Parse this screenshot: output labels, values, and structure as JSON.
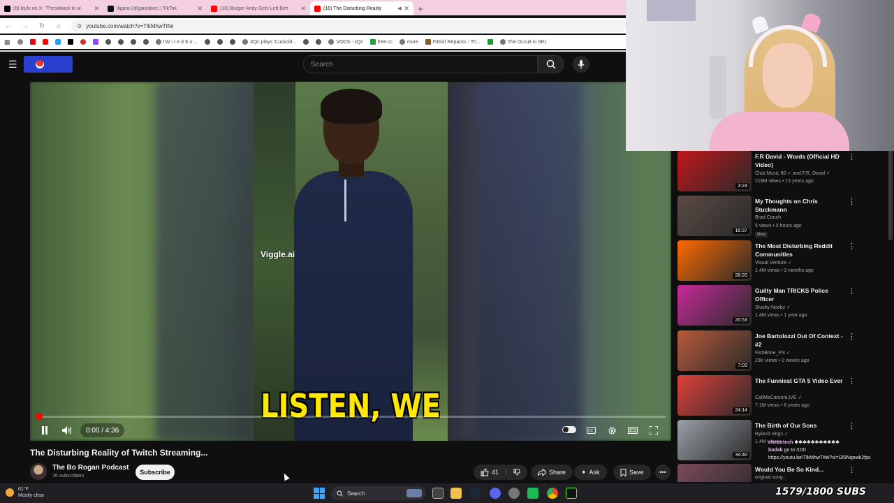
{
  "browser": {
    "tabs": [
      {
        "title": "(6) ItsJx on X: \"Throwback to w",
        "favicon_color": "#000000",
        "active": false
      },
      {
        "title": "lilgara (@garaslive) | TikTok",
        "favicon_color": "#111111",
        "active": false
      },
      {
        "title": "(16) Burger Andy Gets Left Beh",
        "favicon_color": "#ff0000",
        "active": false
      },
      {
        "title": "(16) The Disturbing Reality",
        "favicon_color": "#ff0000",
        "active": true
      }
    ],
    "url": "youtube.com/watch?v=TlkMhwTIfel",
    "bookmarks": [
      "I'W i r e d  S o ...",
      "XQc plays 'Cuckold...",
      "VODS - xQc",
      "free cc",
      "more",
      "FitGirl Repacks - Th...",
      "The Occult in SEL"
    ]
  },
  "youtube": {
    "search_placeholder": "Search",
    "brand_color": "#2a3fcf"
  },
  "player": {
    "watermark": "Viggle.ai",
    "caption": "LISTEN, WE",
    "time": "0:00 / 4:36",
    "progress_fraction": 0.0,
    "state": "playing"
  },
  "video": {
    "title": "The Disturbing Reality of Twitch Streaming...",
    "channel": "The Bo Rogan Podcast",
    "subscribers": "76 subscribers",
    "subscribe_label": "Subscribe",
    "likes": "41",
    "share_label": "Share",
    "ask_label": "Ask",
    "save_label": "Save"
  },
  "recommendations": [
    {
      "title": "F.R David - Words (Official HD Video)",
      "channel": "Club Music 80 ✓ and F.R. David ✓",
      "meta": "216M views • 13 years ago",
      "duration": "3:24",
      "thumb": "#c0161a",
      "new": ""
    },
    {
      "title": "My Thoughts on Chris Stuckmann",
      "channel": "Brad Couch",
      "meta": "5 views • 3 hours ago",
      "duration": "16:37",
      "thumb": "#5a4a44",
      "new": "New"
    },
    {
      "title": "The Most Disturbing Reddit Communities",
      "channel": "Visual Venture ✓",
      "meta": "1.4M views • 3 months ago",
      "duration": "28:20",
      "thumb": "#ff6a00",
      "new": ""
    },
    {
      "title": "Guilty Man TRICKS Police Officer",
      "channel": "Slushy Noobz ✓",
      "meta": "1.4M views • 1 year ago",
      "duration": "20:53",
      "thumb": "#c72a9a",
      "new": ""
    },
    {
      "title": "Joe Bartolozzi Out Of Context - #2",
      "channel": "FishBone_FN ✓",
      "meta": "23K views • 2 weeks ago",
      "duration": "7:03",
      "thumb": "#b85a3a",
      "new": ""
    },
    {
      "title": "The Funniest GTA 5 Video Ever",
      "channel": "CallMeCarsonLIVE ✓",
      "meta": "7.1M views • 6 years ago",
      "duration": "24:14",
      "thumb": "#e0413a",
      "new": ""
    },
    {
      "title": "The Birth of Our Sons",
      "channel": "Ryland vlogs ✓",
      "meta": "1.4M views",
      "duration": "34:40",
      "thumb": "#9aa0a8",
      "new": ""
    },
    {
      "title": "Would You Be So Kind...",
      "channel": "original song...",
      "meta": "",
      "duration": "",
      "thumb": "#7a4a5a",
      "new": ""
    }
  ],
  "chat": [
    {
      "user": "chestrtech",
      "text": "✱✱✱✱✱✱✱✱✱✱✱"
    },
    {
      "user": "bodak",
      "text": "go to 3:00"
    },
    {
      "user": "",
      "text": "https://youtu.be/TlkMhwTIfel?si=Gf3Nqewk2fps"
    }
  ],
  "taskbar": {
    "temp": "61°F",
    "weather": "Mostly clear",
    "search_label": "Search",
    "sub_counter": "1579/1800 SUBS"
  }
}
